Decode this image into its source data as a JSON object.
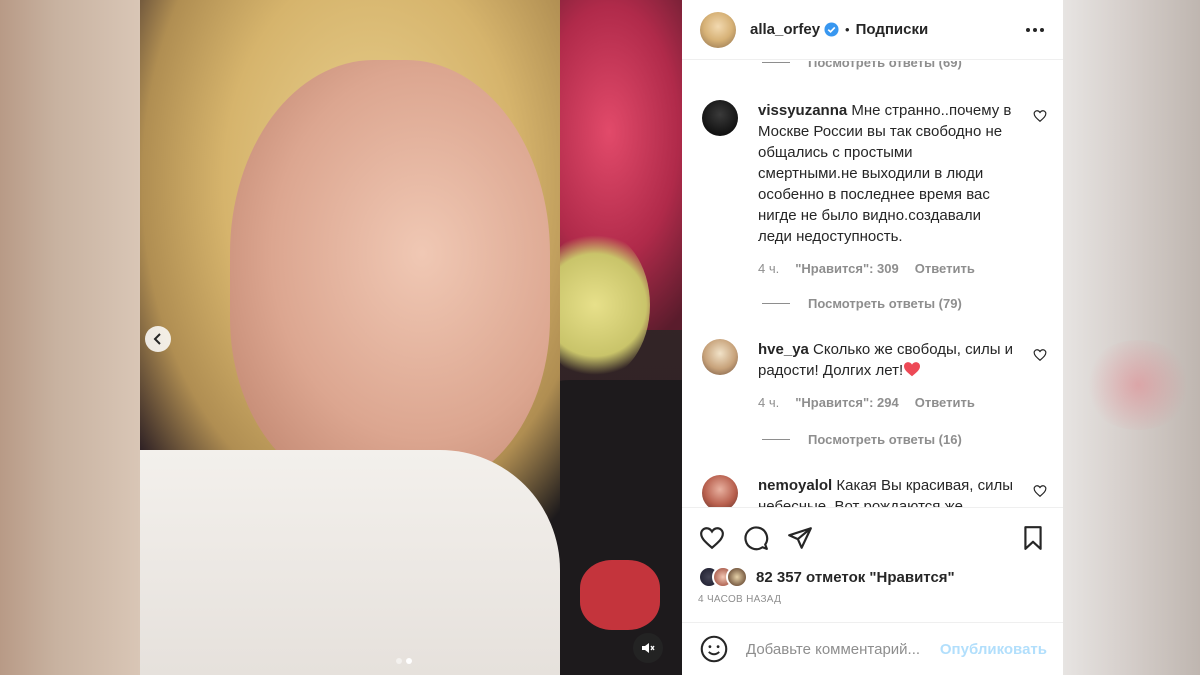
{
  "post": {
    "username": "alla_orfey",
    "separator": "•",
    "follow_label": "Подписки",
    "likes_text": "82 357 отметок \"Нравится\"",
    "time_ago": "4 часов назад"
  },
  "comments": [
    {
      "username": "vissyuzanna",
      "text": "Мне странно..почему в Москве России вы так свободно не общались с простыми смертными.не выходили в люди особенно в последнее время вас нигде не было видно.создавали леди недоступность.",
      "time": "4 ч.",
      "likes": "\"Нравится\": 309",
      "reply_label": "Ответить",
      "view_replies": "Посмотреть ответы (79)"
    },
    {
      "username": "hve_ya",
      "text": "Сколько же свободы, силы и радости! Долгих лет!",
      "time": "4 ч.",
      "likes": "\"Нравится\": 294",
      "reply_label": "Ответить",
      "view_replies": "Посмотреть ответы (16)"
    },
    {
      "username": "nemoyalol",
      "text": "Какая Вы красивая, силы небесные. Вот рождаются же"
    }
  ],
  "top_view_replies": "Посмотреть ответы (69)",
  "add_comment": {
    "placeholder": "Добавьте комментарий...",
    "post_label": "Опубликовать"
  },
  "colors": {
    "verified": "#3897f0",
    "heart": "#ed4956",
    "post_disabled": "#b2dffc",
    "muted_text": "#8e8e8e"
  },
  "icons": [
    "chevron-left-icon",
    "mute-icon",
    "verified-icon",
    "more-icon",
    "heart-icon",
    "comment-icon",
    "share-icon",
    "bookmark-icon",
    "emoji-icon"
  ]
}
